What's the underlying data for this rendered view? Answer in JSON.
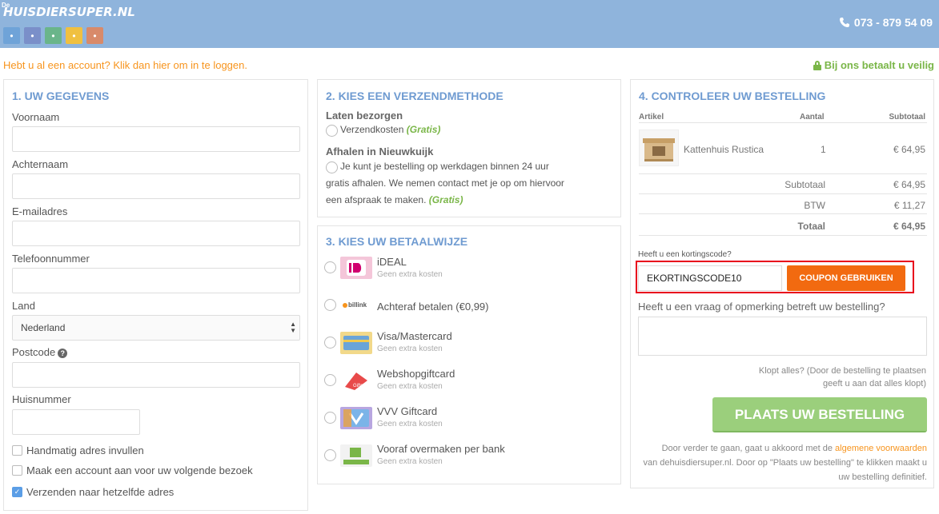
{
  "header": {
    "logo_prefix": "De",
    "logo_text": "HUISDIERSUPER.NL",
    "phone": "073 - 879 54 09",
    "colors": {
      "header_bg": "#8fb4dc",
      "accent_orange": "#f7941d",
      "accent_green": "#7ab648",
      "title_blue": "#6f9bd1"
    }
  },
  "top_bar": {
    "login_text": "Hebt u al een account? Klik dan hier om in te loggen.",
    "secure_text": "Bij ons betaalt u veilig"
  },
  "section1": {
    "title": "1. UW GEGEVENS",
    "fields": {
      "first_name": {
        "label": "Voornaam",
        "value": ""
      },
      "last_name": {
        "label": "Achternaam",
        "value": ""
      },
      "email": {
        "label": "E-mailadres",
        "value": ""
      },
      "phone": {
        "label": "Telefoonnummer",
        "value": ""
      },
      "country": {
        "label": "Land",
        "value": "Nederland"
      },
      "postcode": {
        "label": "Postcode",
        "value": ""
      },
      "house_number": {
        "label": "Huisnummer",
        "value": ""
      }
    },
    "checkboxes": [
      {
        "label": "Handmatig adres invullen",
        "checked": false
      },
      {
        "label": "Maak een account aan voor uw volgende bezoek",
        "checked": false
      },
      {
        "label": "Verzenden naar hetzelfde adres",
        "checked": true
      }
    ]
  },
  "section2": {
    "title": "2. KIES EEN VERZENDMETHODE",
    "delivery_title": "Laten bezorgen",
    "delivery_option": "Verzendkosten",
    "delivery_gratis": "(Gratis)",
    "pickup_title": "Afhalen in Nieuwkuijk",
    "pickup_line1": "Je kunt je bestelling op werkdagen binnen 24 uur",
    "pickup_line2": "gratis afhalen. We nemen contact met je op om hiervoor",
    "pickup_line3": "een afspraak te maken.",
    "pickup_gratis": "(Gratis)"
  },
  "section3": {
    "title": "3. KIES UW BETAALWIJZE",
    "methods": [
      {
        "name": "iDEAL",
        "sub": "Geen extra kosten",
        "icon": "ideal-logo"
      },
      {
        "name": "Achteraf betalen (€0,99)",
        "sub": "",
        "icon": "billink-logo"
      },
      {
        "name": "Visa/Mastercard",
        "sub": "Geen extra kosten",
        "icon": "creditcard-logo"
      },
      {
        "name": "Webshopgiftcard",
        "sub": "Geen extra kosten",
        "icon": "webshopgiftcard-logo"
      },
      {
        "name": "VVV Giftcard",
        "sub": "Geen extra kosten",
        "icon": "vvv-logo"
      },
      {
        "name": "Vooraf overmaken per bank",
        "sub": "Geen extra kosten",
        "icon": "bank-transfer-logo"
      }
    ]
  },
  "section4": {
    "title": "4. CONTROLEER UW BESTELLING",
    "columns": {
      "article": "Artikel",
      "qty": "Aantal",
      "subtotal": "Subtotaal"
    },
    "item": {
      "name": "Kattenhuis Rustica",
      "qty": "1",
      "price": "€ 64,95"
    },
    "totals": {
      "subtotal_label": "Subtotaal",
      "subtotal_value": "€ 64,95",
      "vat_label": "BTW",
      "vat_value": "€ 11,27",
      "total_label": "Totaal",
      "total_value": "€ 64,95"
    },
    "coupon_label": "Heeft u een kortingscode?",
    "coupon_value": "EKORTINGSCODE10",
    "coupon_button": "COUPON GEBRUIKEN",
    "question_label": "Heeft u een vraag of opmerking betreft uw bestelling?",
    "question_value": "",
    "confirm_line1": "Klopt alles? (Door de bestelling te plaatsen",
    "confirm_line2": "geeft u aan dat alles klopt)",
    "place_button": "PLAATS UW BESTELLING",
    "terms_prefix": "Door verder te gaan, gaat u akkoord met de",
    "terms_link": "algemene voorwaarden",
    "terms_line2": "van dehuisdiersuper.nl. Door op \"Plaats uw bestelling\" te klikken maakt u",
    "terms_line3": "uw bestelling definitief."
  }
}
